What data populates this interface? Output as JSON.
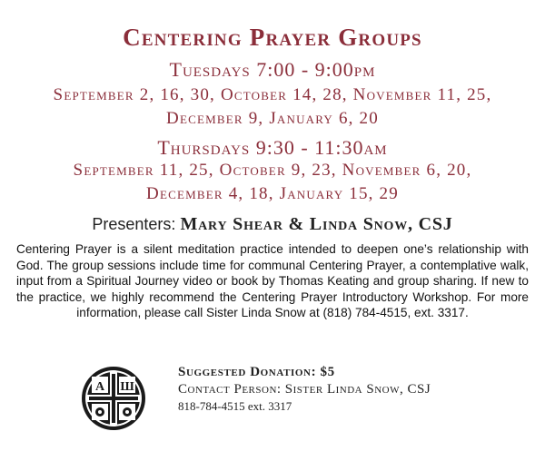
{
  "title": "Centering Prayer Groups",
  "tuesdays": {
    "heading": "Tuesdays 7:00 - 9:00pm",
    "dates_line1": "September 2, 16, 30, October 14, 28, November 11, 25,",
    "dates_line2": "December 9, January 6, 20"
  },
  "thursdays": {
    "heading": "Thursdays 9:30 - 11:30am",
    "dates_line1": "September 11, 25, October 9, 23, November 6, 20,",
    "dates_line2": "December 4, 18, January 15, 29"
  },
  "presenters": {
    "label": "Presenters:",
    "names": "Mary Shear & Linda Snow, CSJ"
  },
  "description": "Centering Prayer is a silent meditation practice intended to deepen one’s relationship with God. The group sessions include time for communal Centering Prayer, a contemplative walk, input from a Spiritual Journey video or book by Thomas Keating and group sharing. If new to the practice, we highly recommend the Centering Prayer Introductory Workshop. For more information, please call Sister Linda Snow at (818) 784-4515, ext. 3317.",
  "contact": {
    "donation": "Suggested Donation: $5",
    "person": "Contact Person:  Sister Linda Snow, CSJ",
    "phone": "818-784-4515 ext. 3317"
  },
  "logo": {
    "icon": "csj-cross-seal-icon",
    "lettering": "A Ш"
  },
  "colors": {
    "accent": "#8b2e3a",
    "body_text": "#111111",
    "background": "#ffffff"
  }
}
